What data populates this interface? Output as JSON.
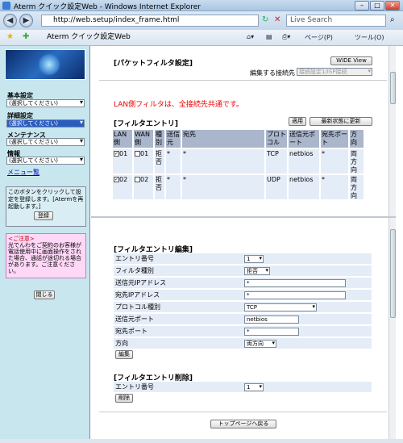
{
  "window": {
    "title": "Aterm クイック設定Web - Windows Internet Explorer",
    "url": "http://web.setup/index_frame.html",
    "search_placeholder": "Live Search",
    "tab": "Aterm クイック設定Web",
    "page_menu": "ページ(P)",
    "tools_menu": "ツール(O)"
  },
  "sidebar": {
    "groups": [
      {
        "label": "基本設定",
        "value": "(選択してください)"
      },
      {
        "label": "詳細設定",
        "value": "(選択してください)"
      },
      {
        "label": "メンテナンス",
        "value": "(選択してください)"
      },
      {
        "label": "情報",
        "value": "(選択してください)"
      }
    ],
    "menu_link": "メニュー覧",
    "register_text": "このボタンをクリックして設定を登録します。[Atermを再起動します。]",
    "register_button": "登録",
    "caution_title": "<ご注意>",
    "caution_text": "光でんわをご契約のお客様が電話使用中に画面操作をされた場合、通話が途切れる場合があります。ご注意ください。",
    "close_button": "閉じる"
  },
  "top": {
    "title": "[パケットフィルタ設定]",
    "wide_view": "WIDE View",
    "edit_target_label": "編集する接続先",
    "edit_target_value": "接続設定1/ISP接続",
    "notice": "LAN側フィルタは、全接続先共通です。",
    "entry_title": "[フィルタエントリ]",
    "apply_button": "適用",
    "refresh_button": "最新状態に更新",
    "columns": [
      "LAN側",
      "WAN側",
      "種別",
      "送信元",
      "宛先",
      "プロトコル",
      "送信元ポート",
      "宛先ポート",
      "方向"
    ],
    "rows": [
      {
        "lan": "01",
        "lan_checked": true,
        "wan": "01",
        "wan_checked": false,
        "type": "拒否",
        "src": "*",
        "dst": "*",
        "proto": "TCP",
        "sport": "netbios",
        "dport": "*",
        "dir": "両方向"
      },
      {
        "lan": "02",
        "lan_checked": true,
        "wan": "02",
        "wan_checked": false,
        "type": "拒否",
        "src": "*",
        "dst": "*",
        "proto": "UDP",
        "sport": "netbios",
        "dport": "*",
        "dir": "両方向"
      }
    ]
  },
  "edit": {
    "title": "[フィルタエントリ編集]",
    "fields": [
      {
        "label": "エントリ番号",
        "value": "1"
      },
      {
        "label": "フィルタ種別",
        "value": "拒否"
      },
      {
        "label": "送信元IPアドレス",
        "value": "*"
      },
      {
        "label": "宛先IPアドレス",
        "value": "*"
      },
      {
        "label": "プロトコル種別",
        "value": "TCP"
      },
      {
        "label": "送信元ポート",
        "value": "netbios"
      },
      {
        "label": "宛先ポート",
        "value": "*"
      },
      {
        "label": "方向",
        "value": "両方向"
      }
    ],
    "edit_button": "編集",
    "delete_title": "[フィルタエントリ削除]",
    "delete_field_label": "エントリ番号",
    "delete_field_value": "1",
    "delete_button": "削除",
    "top_button": "トップページへ戻る"
  }
}
